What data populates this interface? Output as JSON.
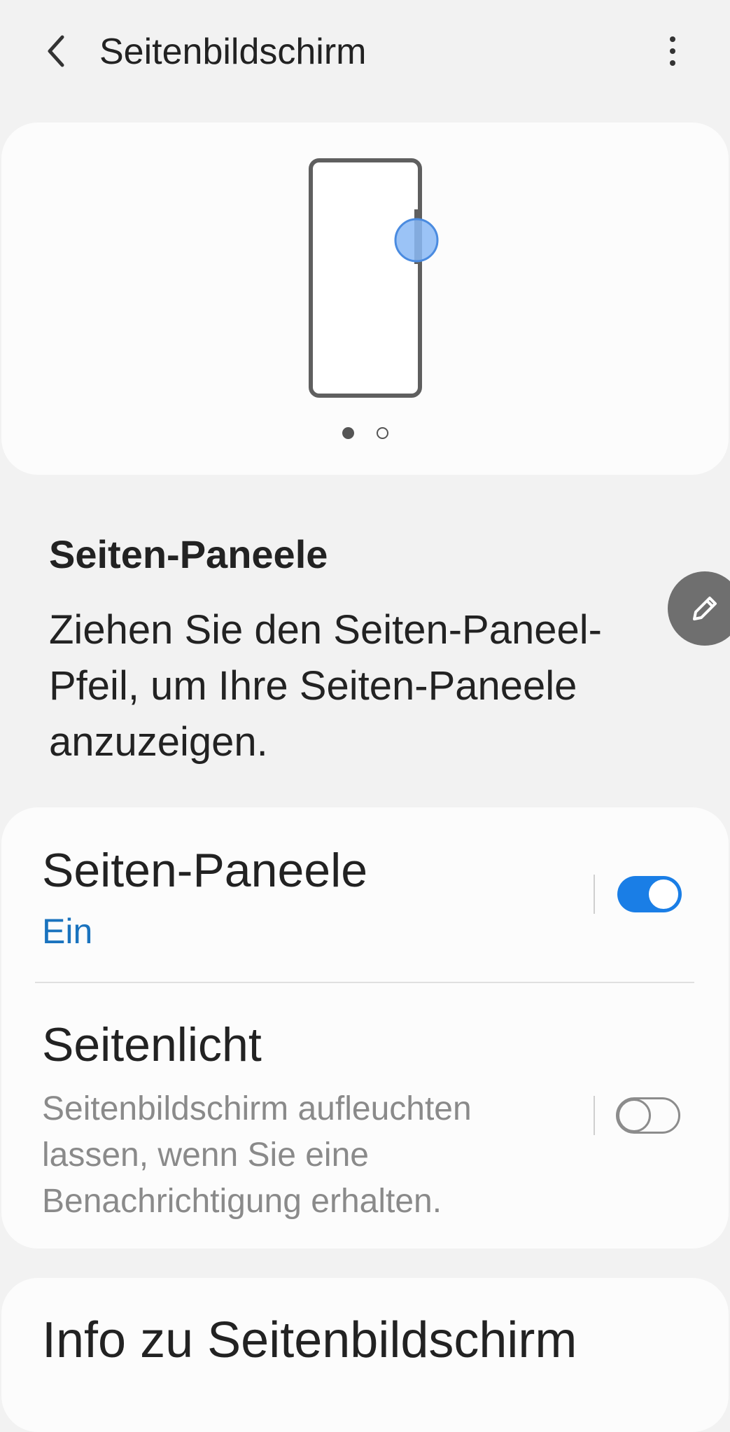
{
  "header": {
    "title": "Seitenbildschirm",
    "back_icon": "chevron-left-icon",
    "more_icon": "more-vertical-icon"
  },
  "illustration": {
    "icon": "phone-edge-handle-illustration",
    "accent": "#8ab8f5",
    "pager": {
      "count": 2,
      "active_index": 0
    }
  },
  "description": {
    "heading": "Seiten-Paneele",
    "body": "Ziehen Sie den Seiten-Paneel-Pfeil, um Ihre Seiten-Paneele anzuzeigen."
  },
  "edit_fab": {
    "icon": "pencil-icon"
  },
  "settings": [
    {
      "title": "Seiten-Paneele",
      "subtitle": "Ein",
      "toggle_on": true
    },
    {
      "title": "Seitenlicht",
      "subtitle": "Seitenbildschirm aufleuchten lassen, wenn Sie eine Benachrichtigung erhalten.",
      "toggle_on": false
    }
  ],
  "info": {
    "title": "Info zu Seitenbildschirm"
  },
  "colors": {
    "accent": "#1a7ee6",
    "subtitle_on": "#1a73be",
    "background": "#f2f2f2",
    "card": "#fcfcfc"
  }
}
